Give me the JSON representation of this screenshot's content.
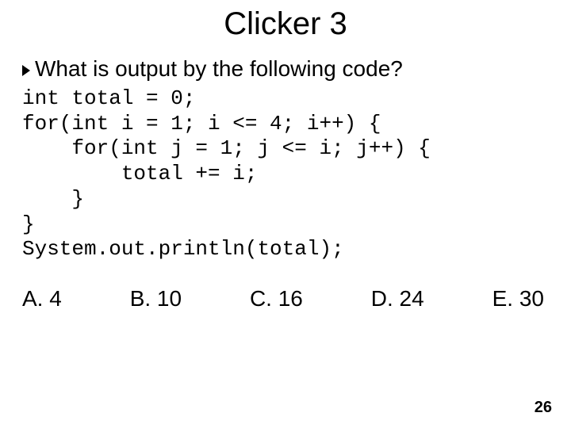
{
  "slide": {
    "title": "Clicker 3",
    "question": "What is output by the following code?",
    "code": "int total = 0;\nfor(int i = 1; i <= 4; i++) {\n    for(int j = 1; j <= i; j++) {\n        total += i;\n    }\n}\nSystem.out.println(total);",
    "answers": {
      "a": "A. 4",
      "b": "B. 10",
      "c": "C. 16",
      "d": "D. 24",
      "e": "E. 30"
    },
    "page_number": "26"
  }
}
